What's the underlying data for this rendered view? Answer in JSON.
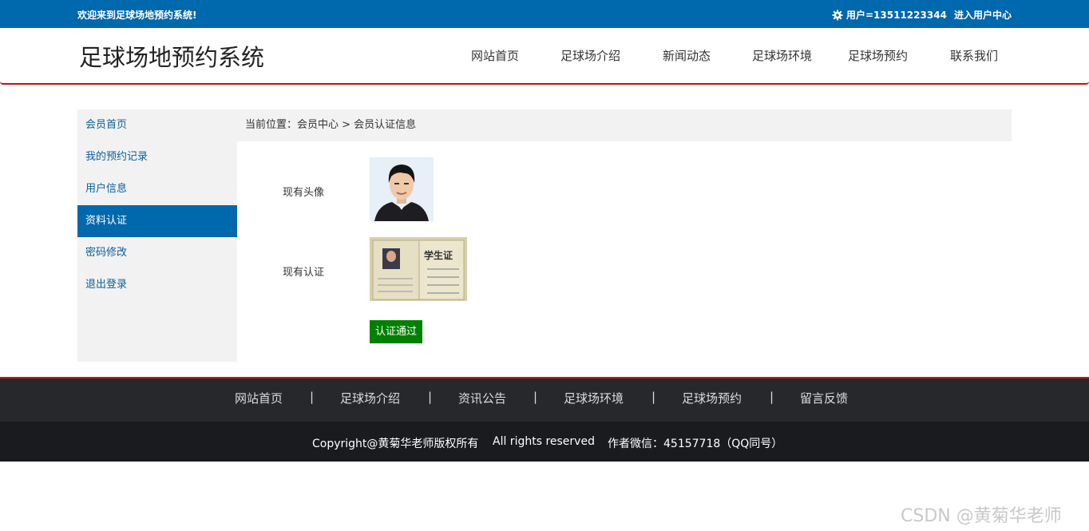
{
  "topbar": {
    "welcome": "欢迎来到足球场地预约系统!",
    "user_label": "用户=13511223344",
    "user_center": "进入用户中心"
  },
  "header": {
    "site_title": "足球场地预约系统",
    "nav": [
      "网站首页",
      "足球场介绍",
      "新闻动态",
      "足球场环境",
      "足球场预约",
      "联系我们"
    ]
  },
  "sidebar": {
    "items": [
      "会员首页",
      "我的预约记录",
      "用户信息",
      "资料认证",
      "密码修改",
      "退出登录"
    ],
    "active": "资料认证"
  },
  "breadcrumb": {
    "text": "当前位置：会员中心 > 会员认证信息"
  },
  "content": {
    "avatar_label": "现有头像",
    "cert_label": "现有认证",
    "cert_title": "学生证",
    "status_label": "认证通过"
  },
  "footer": {
    "nav": [
      "网站首页",
      "足球场介绍",
      "资讯公告",
      "足球场环境",
      "足球场预约",
      "留言反馈"
    ],
    "separator": "|",
    "copyright": "Copyright@黄菊华老师版权所有",
    "rights": "All rights reserved",
    "contact": "作者微信：45157718（QQ同号）"
  },
  "watermark": "CSDN @黄菊华老师",
  "colors": {
    "brand_blue": "#0068ad",
    "accent_red": "#c4161c",
    "status_green": "#008000",
    "footer_dark": "#26282c"
  }
}
